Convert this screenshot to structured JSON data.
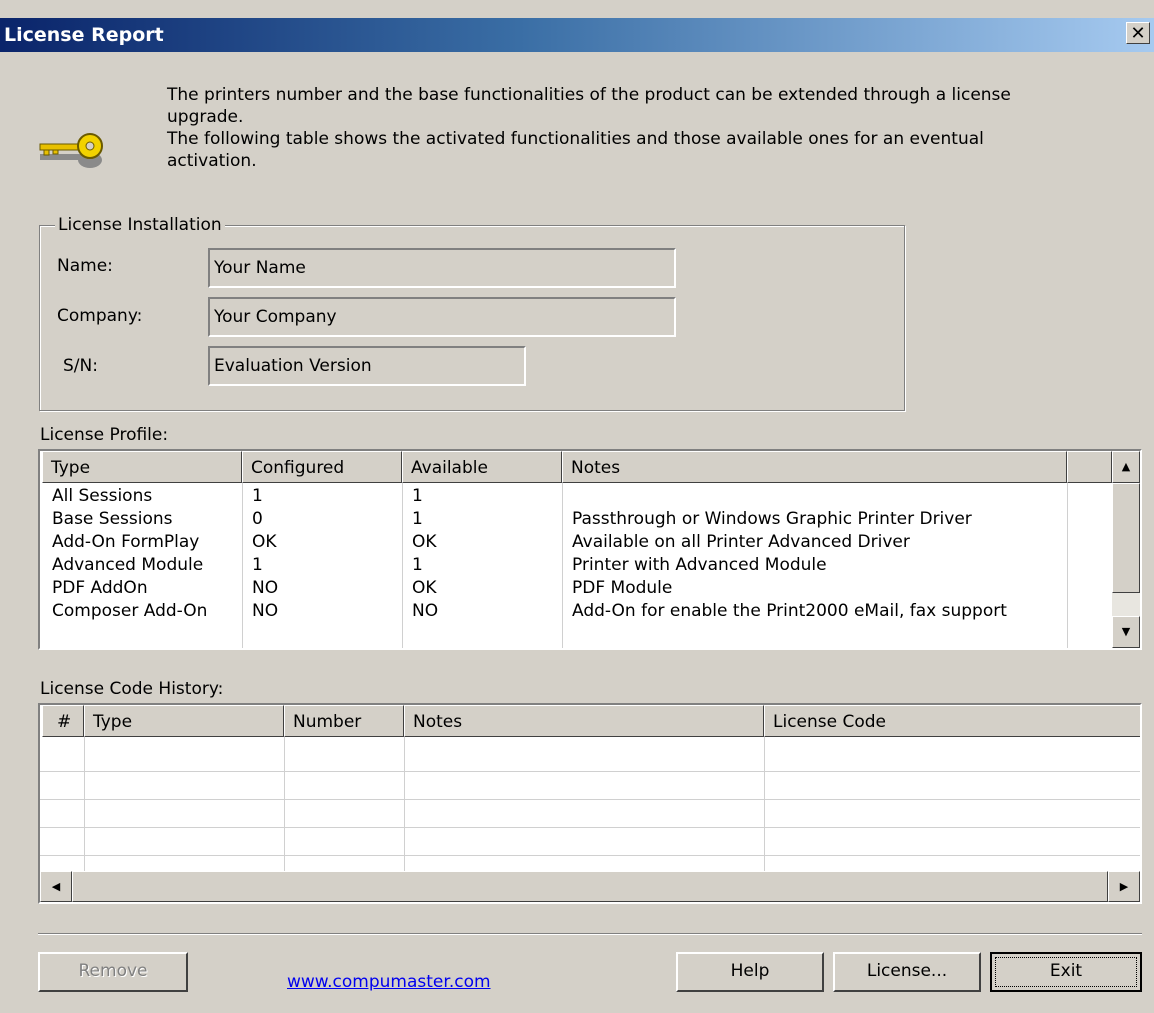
{
  "window": {
    "title": "License Report",
    "close_label": "✕"
  },
  "intro": {
    "line1": "The printers number and the base functionalities of the product can be extended through a license",
    "line2": "upgrade.",
    "line3": "The following table shows the activated functionalities and those available ones for an eventual",
    "line4": "activation."
  },
  "installation": {
    "legend": "License Installation",
    "name_label": "Name:",
    "name_value": "Your Name",
    "company_label": "Company:",
    "company_value": "Your Company",
    "sn_label": "S/N:",
    "sn_value": "Evaluation Version"
  },
  "profile": {
    "label": "License Profile:",
    "headers": [
      "Type",
      "Configured",
      "Available",
      "Notes"
    ],
    "rows": [
      [
        "All Sessions",
        "1",
        "1",
        ""
      ],
      [
        "Base Sessions",
        "0",
        "1",
        "Passthrough or Windows Graphic Printer Driver"
      ],
      [
        "Add-On FormPlay",
        "OK",
        "OK",
        "Available on all Printer Advanced Driver"
      ],
      [
        "Advanced Module",
        "1",
        "1",
        "Printer with Advanced Module"
      ],
      [
        "PDF AddOn",
        "NO",
        "OK",
        "PDF Module"
      ],
      [
        "Composer Add-On",
        "NO",
        "NO",
        "Add-On for enable the Print2000 eMail, fax support"
      ]
    ]
  },
  "history": {
    "label": "License Code History:",
    "headers": [
      "#",
      "Type",
      "Number",
      "Notes",
      "License Code"
    ]
  },
  "footer": {
    "remove_label": "Remove",
    "link_text": "www.compumaster.com",
    "help_label": "Help",
    "license_label": "License...",
    "exit_label": "Exit"
  }
}
